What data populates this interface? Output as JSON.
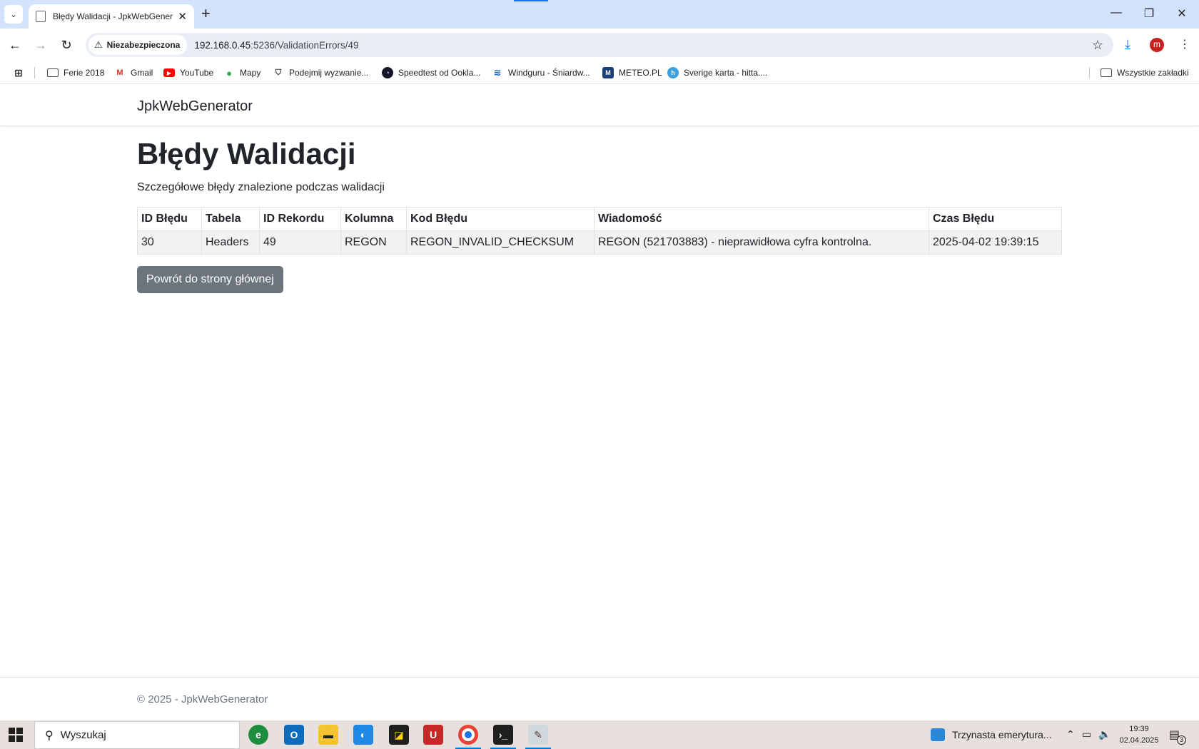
{
  "browser": {
    "tab_title": "Błędy Walidacji - JpkWebGenerator",
    "tab_close": "✕",
    "new_tab": "+",
    "security_label": "Niezabezpieczona",
    "url_host": "192.168.0.45",
    "url_rest": ":5236/ValidationErrors/49",
    "profile_initial": "m",
    "window_controls": {
      "minimize": "—",
      "restore": "❐",
      "close": "✕"
    }
  },
  "bookmarks": {
    "items": [
      {
        "label": "Ferie 2018",
        "icon": "folder-icon"
      },
      {
        "label": "Gmail",
        "icon": "gmail-icon"
      },
      {
        "label": "YouTube",
        "icon": "youtube-icon"
      },
      {
        "label": "Mapy",
        "icon": "maps-icon"
      },
      {
        "label": "Podejmij wyzwanie...",
        "icon": "shield-icon"
      },
      {
        "label": "Speedtest od Ookla...",
        "icon": "speedtest-icon"
      },
      {
        "label": "Windguru - Śniardw...",
        "icon": "windguru-icon"
      },
      {
        "label": "METEO.PL",
        "icon": "meteo-icon"
      },
      {
        "label": "Sverige karta - hitta....",
        "icon": "hitta-icon"
      }
    ],
    "all_bookmarks": "Wszystkie zakładki"
  },
  "page": {
    "brand": "JpkWebGenerator",
    "title": "Błędy Walidacji",
    "subtitle": "Szczegółowe błędy znalezione podczas walidacji",
    "table": {
      "headers": [
        "ID Błędu",
        "Tabela",
        "ID Rekordu",
        "Kolumna",
        "Kod Błędu",
        "Wiadomość",
        "Czas Błędu"
      ],
      "rows": [
        [
          "30",
          "Headers",
          "49",
          "REGON",
          "REGON_INVALID_CHECKSUM",
          "REGON (521703883) - nieprawidłowa cyfra kontrolna.",
          "2025-04-02 19:39:15"
        ]
      ]
    },
    "back_button": "Powrót do strony głównej",
    "footer": "© 2025 - JpkWebGenerator"
  },
  "taskbar": {
    "search_placeholder": "Wyszukaj",
    "news_text": "Trzynasta emerytura...",
    "time": "19:39",
    "date": "02.04.2025",
    "notification_count": "3",
    "colors": {
      "accent": "#0078d4",
      "button_secondary": "#6c757d"
    }
  }
}
